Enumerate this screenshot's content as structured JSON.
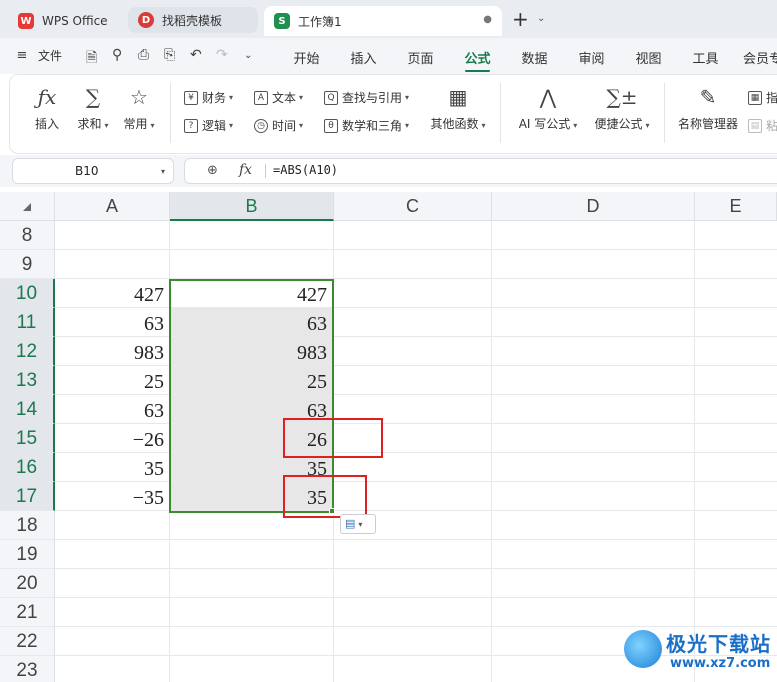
{
  "tabs": [
    {
      "label": "WPS Office",
      "logo": "W"
    },
    {
      "label": "找稻壳模板",
      "logo": "D"
    },
    {
      "label": "工作簿1",
      "logo": "S"
    }
  ],
  "tab_close": "●",
  "new_tab": "+",
  "menubar": {
    "file_label": "文件",
    "tabs": [
      "开始",
      "插入",
      "页面",
      "公式",
      "数据",
      "审阅",
      "视图",
      "工具",
      "会员专"
    ],
    "active_tab": "公式"
  },
  "ribbon": {
    "insert_fn": "插入",
    "sum": "求和",
    "common": "常用",
    "finance": "财务",
    "text": "文本",
    "lookup": "查找与引用",
    "logic": "逻辑",
    "time": "时间",
    "math": "数学和三角",
    "other_fn": "其他函数",
    "ai_formula": "AI 写公式",
    "quick_formula": "便捷公式",
    "name_manager": "名称管理器",
    "partial1": "指",
    "partial2": "粘"
  },
  "formula_bar": {
    "cell_ref": "B10",
    "fx": "fx",
    "formula": "=ABS(A10)"
  },
  "grid": {
    "columns": [
      "A",
      "B",
      "C",
      "D",
      "E"
    ],
    "selected_column": "B",
    "rows": [
      "8",
      "9",
      "10",
      "11",
      "12",
      "13",
      "14",
      "15",
      "16",
      "17",
      "18",
      "19",
      "20",
      "21",
      "22",
      "23"
    ],
    "selected_rows": [
      "10",
      "11",
      "12",
      "13",
      "14",
      "15",
      "16",
      "17"
    ],
    "col_a_values": [
      "427",
      "63",
      "983",
      "25",
      "63",
      "−26",
      "35",
      "−35"
    ],
    "col_b_values": [
      "427",
      "63",
      "983",
      "25",
      "63",
      "26",
      "35",
      "35"
    ]
  },
  "colors": {
    "accent": "#1a7a4c",
    "selection_border": "#3a8a2e",
    "highlight_red": "#e02020"
  },
  "watermark": {
    "title": "极光下载站",
    "url": "www.xz7.com"
  }
}
